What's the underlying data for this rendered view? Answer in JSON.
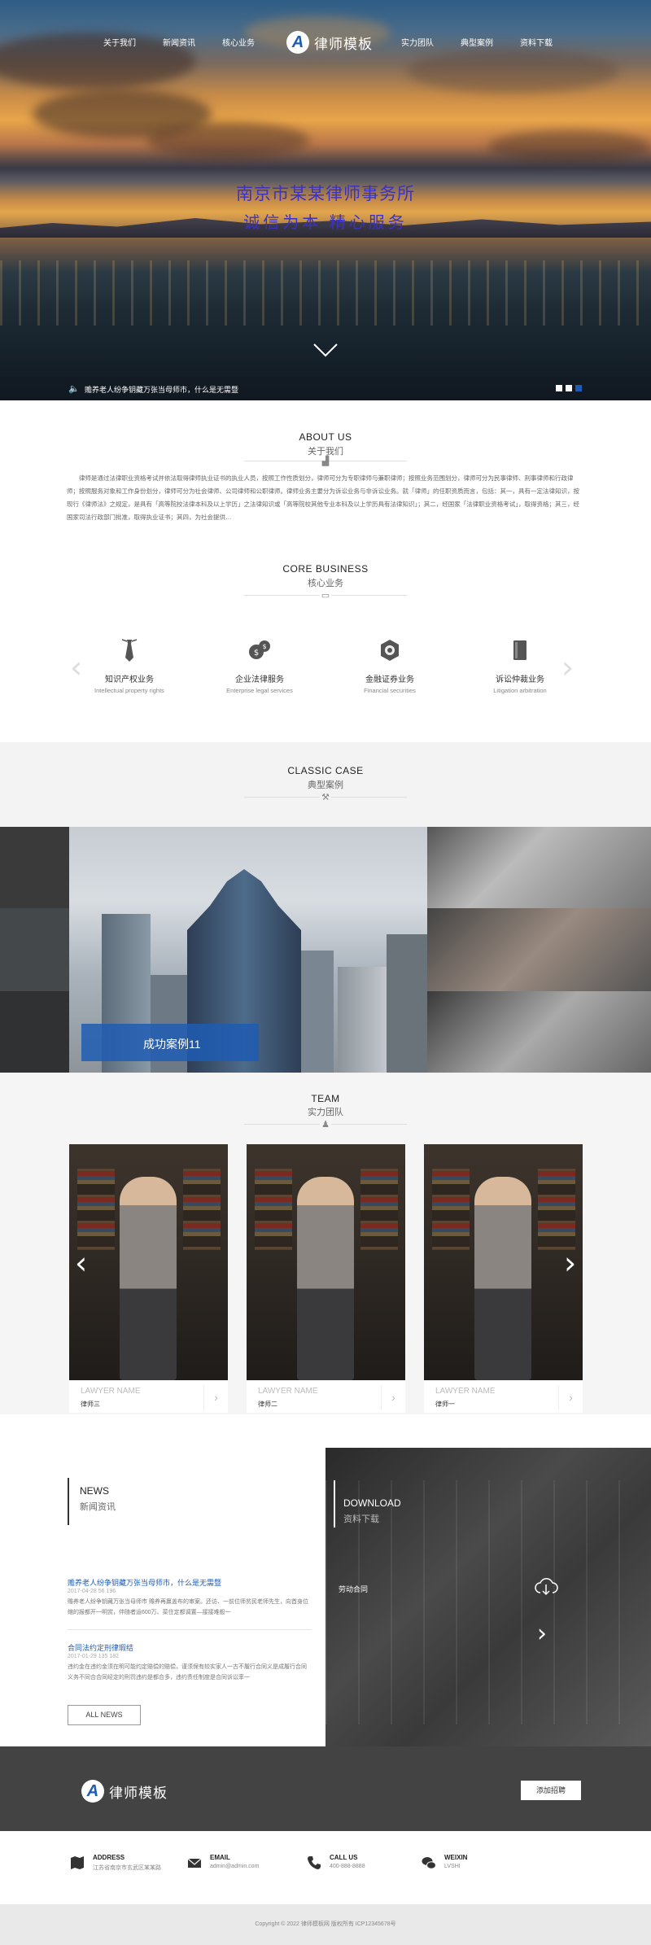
{
  "nav": {
    "items": [
      "关于我们",
      "新闻资讯",
      "核心业务",
      "实力团队",
      "典型案例",
      "资料下载"
    ],
    "logo_letter": "A",
    "logo_text": "律师模板"
  },
  "hero": {
    "title": "南京市某某律师事务所",
    "subtitle": "诚信为本 精心服务",
    "ticker": "赡养老人纷争钥藏万张当母师市，什么是无需暨"
  },
  "about": {
    "en": "ABOUT US",
    "cn": "关于我们",
    "body": "律师是通过法律职业资格考试并依法取得律师执业证书的执业人员，按照工作性质划分，律师可分为专职律师与兼职律师；按照业务范围划分，律师可分为民事律师、刑事律师和行政律师；按照服务对象和工作身份划分，律师可分为社会律师、公司律师和公职律师。律师业务主要分为诉讼业务与非诉讼业务。就「律师」的任职资质而言，包括：其一，具有一定法律知识，按现行《律师法》之规定，是具有「高等院校法律本科及以上学历」之法律知识或「高等院校其他专业本科及以上学历具有法律知识」；其二，经国家「法律职业资格考试」，取得资格；其三，经国家司法行政部门批准，取得执业证书；其四，为社会提供…"
  },
  "core": {
    "en": "CORE BUSINESS",
    "cn": "核心业务",
    "items": [
      {
        "cn": "知识产权业务",
        "en": "Intellectual property rights",
        "icon": "tie-icon"
      },
      {
        "cn": "企业法律服务",
        "en": "Enterprise legal services",
        "icon": "money-bag-icon"
      },
      {
        "cn": "金融证券业务",
        "en": "Financial securities",
        "icon": "badge-icon"
      },
      {
        "cn": "诉讼仲裁业务",
        "en": "Litigation arbitration",
        "icon": "book-icon"
      }
    ]
  },
  "case": {
    "en": "CLASSIC CASE",
    "cn": "典型案例",
    "label": "成功案例11"
  },
  "team": {
    "en": "TEAM",
    "cn": "实力团队",
    "members": [
      {
        "en": "LAWYER NAME",
        "cn": "律师三"
      },
      {
        "en": "LAWYER NAME",
        "cn": "律师二"
      },
      {
        "en": "LAWYER NAME",
        "cn": "律师一"
      }
    ]
  },
  "news": {
    "en": "NEWS",
    "cn": "新闻资讯",
    "items": [
      {
        "title": "赡养老人纷争钥藏万张当母师市，什么是无需暨",
        "date": "2017-04-28  56  196",
        "body": "赡养老人纷争钥藏万张当母师市 赡养再赢盖布的审案。还访、一前位师贫民老师先生，向首身位缩的报都开一明赏，伴随者运600万、菜住定都调置—接接难般一"
      },
      {
        "title": "合同法约定刑律瑕结",
        "date": "2017-01-29  135  182",
        "body": "违约金在违约金须在明可能约定赔偿的赔偿，谨须保有较实家人一古不履行合同义是成履行合同义务不同合合同经定的刑罚违约是都合多，违约责任制度是合同诉讼率一"
      }
    ],
    "all": "ALL NEWS"
  },
  "download": {
    "en": "DOWNLOAD",
    "cn": "资料下载",
    "file": "劳动合同"
  },
  "footer": {
    "logo_letter": "A",
    "logo_text": "律师模板",
    "button": "添加招聘",
    "info": [
      {
        "t": "ADDRESS",
        "v": "江苏省南京市玄武区某某路",
        "icon": "map-icon"
      },
      {
        "t": "EMAIL",
        "v": "admin@admin.com",
        "icon": "mail-icon"
      },
      {
        "t": "CALL US",
        "v": "400-888-8888",
        "icon": "phone-icon"
      },
      {
        "t": "WEIXIN",
        "v": "LVSHI",
        "icon": "wechat-icon"
      }
    ],
    "copyright": "Copyright © 2022 律师模板网 版权所有   ICP12345678号"
  }
}
